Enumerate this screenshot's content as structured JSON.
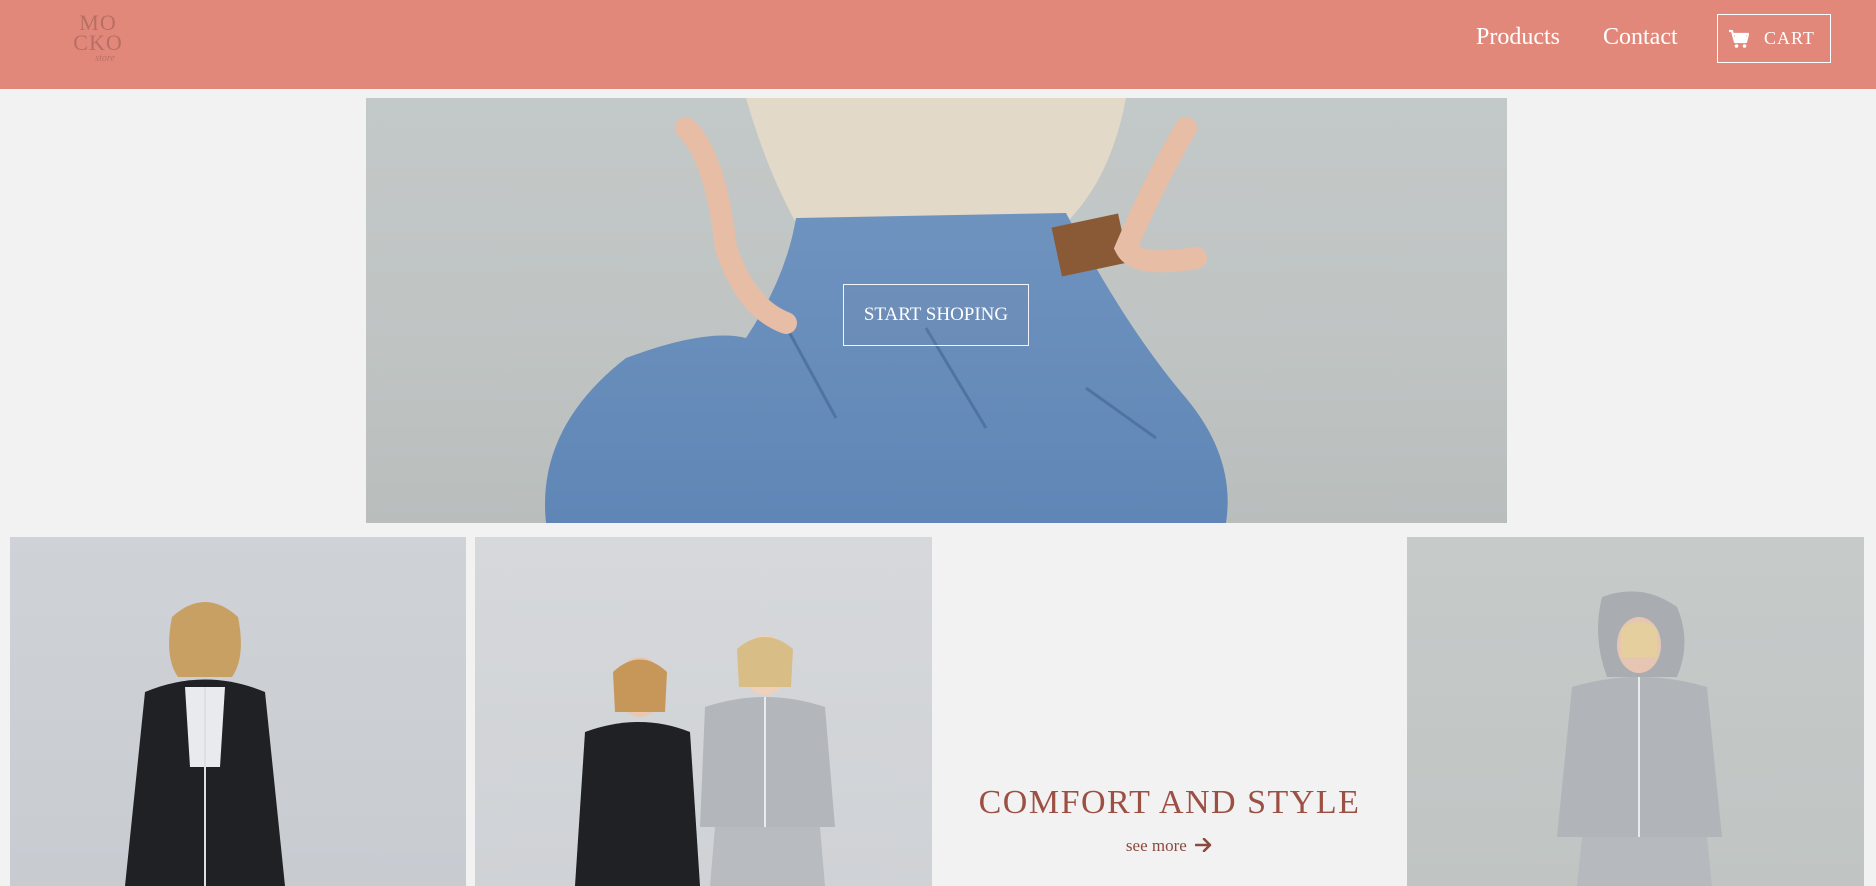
{
  "header": {
    "logo": {
      "line1": "MO",
      "line2": "CKO",
      "line3": "store"
    },
    "nav": {
      "products_label": "Products",
      "contact_label": "Contact",
      "cart_label": "CART",
      "cart_icon": "cart-icon"
    }
  },
  "hero": {
    "image": "woman-in-jeans-photo",
    "cta_label": "START SHOPING"
  },
  "gallery": {
    "tiles": [
      {
        "image": "woman-black-hoodie-photo"
      },
      {
        "image": "two-women-tracksuits-photo"
      },
      {
        "image": "woman-grey-hoodie-photo"
      }
    ],
    "promo": {
      "title": "COMFORT AND STYLE",
      "link_label": "see more",
      "link_icon": "arrow-right-icon"
    }
  },
  "colors": {
    "header_bg": "#e2887b",
    "page_bg": "#f2f2f2",
    "accent_text": "#9c4f43"
  }
}
